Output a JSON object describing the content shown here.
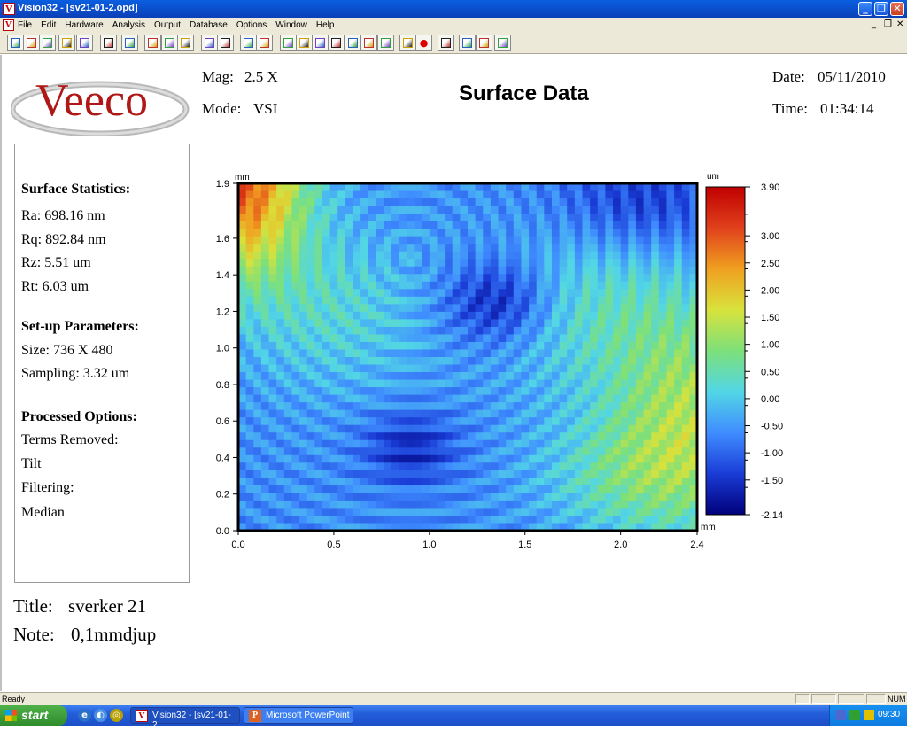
{
  "window": {
    "title": "Vision32 - [sv21-01-2.opd]",
    "app_icon": "V",
    "buttons": [
      "_",
      "❐",
      "✕"
    ]
  },
  "menubar": {
    "items": [
      "File",
      "Edit",
      "Hardware",
      "Analysis",
      "Output",
      "Database",
      "Options",
      "Window",
      "Help"
    ],
    "mdi_controls": [
      "_",
      "❐",
      "✕"
    ]
  },
  "toolbar": {
    "icons": [
      "new-icon",
      "open-icon",
      "save-icon",
      "print-preview-icon",
      "print-icon",
      "blank-page-icon",
      "sparkle-icon",
      "measure-icon",
      "stitch-icon",
      "color-icon",
      "view1-icon",
      "view2-icon",
      "tools-icon",
      "copy-icon",
      "palette-icon",
      "line-profile-icon",
      "3d-icon",
      "zoom-icon",
      "histogram-icon",
      "slope-icon",
      "frame-icon",
      "disabled-icon",
      "record-icon",
      "stop-icon",
      "settings-icon",
      "cursor-icon",
      "ml-icon",
      "help-icon"
    ]
  },
  "report": {
    "logo_text": "Veeco",
    "mag_label": "Mag:",
    "mag_value": "2.5 X",
    "mode_label": "Mode:",
    "mode_value": "VSI",
    "title": "Surface Data",
    "date_label": "Date:",
    "date_value": "05/11/2010",
    "time_label": "Time:",
    "time_value": "01:34:14",
    "stats": {
      "heading1": "Surface Statistics:",
      "ra": "Ra:  698.16 nm",
      "rq": "Rq:  892.84 nm",
      "rz": "Rz:  5.51 um",
      "rt": "Rt:  6.03 um",
      "heading2": "Set-up Parameters:",
      "size": "Size: 736 X 480",
      "sampling": "Sampling:  3.32 um",
      "heading3": "Processed Options:",
      "terms": "Terms Removed:",
      "tilt": "Tilt",
      "filtering": "Filtering:",
      "median": "Median"
    },
    "title_label": "Title:",
    "title_value": "sverker 21",
    "note_label": "Note:",
    "note_value": "0,1mmdjup"
  },
  "chart_data": {
    "type": "heatmap",
    "x_unit": "mm",
    "y_unit": "mm",
    "z_unit": "um",
    "xlim": [
      0,
      2.4
    ],
    "ylim": [
      0,
      1.9
    ],
    "x_ticks": [
      "0.0",
      "0.5",
      "1.0",
      "1.5",
      "2.0",
      "2.4"
    ],
    "x_tick_values": [
      0,
      0.5,
      1.0,
      1.5,
      2.0,
      2.4
    ],
    "y_ticks": [
      "0.0",
      "0.2",
      "0.4",
      "0.6",
      "0.8",
      "1.0",
      "1.2",
      "1.4",
      "1.6",
      "1.9"
    ],
    "y_tick_values": [
      0,
      0.2,
      0.4,
      0.6,
      0.8,
      1.0,
      1.2,
      1.4,
      1.6,
      1.9
    ],
    "colorbar_labels": [
      "3.90",
      "3.00",
      "2.50",
      "2.00",
      "1.50",
      "1.00",
      "0.50",
      "0.00",
      "-0.50",
      "-1.00",
      "-1.50",
      "-2.14"
    ],
    "colorbar_values": [
      3.9,
      3.0,
      2.5,
      2.0,
      1.5,
      1.0,
      0.5,
      0.0,
      -0.5,
      -1.0,
      -1.5,
      -2.14
    ],
    "zlim": [
      -2.14,
      3.9
    ],
    "colormap": [
      "#00007a",
      "#1a3cd6",
      "#3f8cff",
      "#52d6e6",
      "#7de07a",
      "#d8e23c",
      "#f0a020",
      "#e0401c",
      "#c00000"
    ]
  },
  "statusbar": {
    "ready": "Ready",
    "num": "NUM"
  },
  "taskbar": {
    "start": "start",
    "tasks": [
      "Vision32 - [sv21-01-2...",
      "Microsoft PowerPoint ..."
    ],
    "clock": "09:30"
  }
}
